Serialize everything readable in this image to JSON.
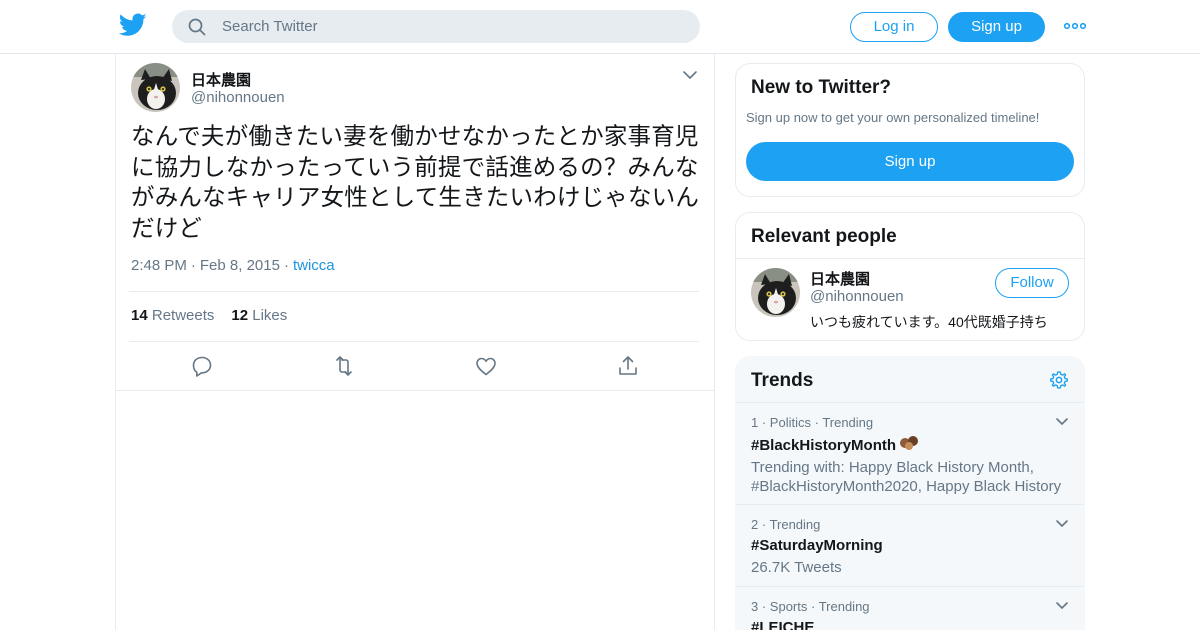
{
  "header": {
    "search_placeholder": "Search Twitter",
    "login_label": "Log in",
    "signup_label": "Sign up",
    "brand_color": "#1da1f2"
  },
  "tweet": {
    "display_name": "日本農園",
    "handle": "@nihonnouen",
    "text": "なんで夫が働きたい妻を働かせなかったとか家事育児に協力しなかったっていう前提で話進めるの？みんながみんなキャリア女性として生きたいわけじゃないんだけど",
    "time": "2:48 PM",
    "date": "Feb 8, 2015",
    "source": "twicca",
    "retweets_count": "14",
    "retweets_label": "Retweets",
    "likes_count": "12",
    "likes_label": "Likes"
  },
  "new_to_twitter": {
    "title": "New to Twitter?",
    "subtitle": "Sign up now to get your own personalized timeline!",
    "button": "Sign up"
  },
  "relevant_people": {
    "title": "Relevant people",
    "person": {
      "name": "日本農園",
      "handle": "@nihonnouen",
      "bio": "いつも疲れています。40代既婚子持ち",
      "follow_label": "Follow"
    }
  },
  "trends": {
    "title": "Trends",
    "items": [
      {
        "rank": "1",
        "category": "Politics",
        "status": "Trending",
        "name": "#BlackHistoryMonth",
        "description": "Trending with: Happy Black History Month, #BlackHistoryMonth2020, Happy Black History"
      },
      {
        "rank": "2",
        "category": "",
        "status": "Trending",
        "name": "#SaturdayMorning",
        "description": "26.7K Tweets"
      },
      {
        "rank": "3",
        "category": "Sports",
        "status": "Trending",
        "name": "#LEICHE",
        "description": ""
      }
    ]
  }
}
